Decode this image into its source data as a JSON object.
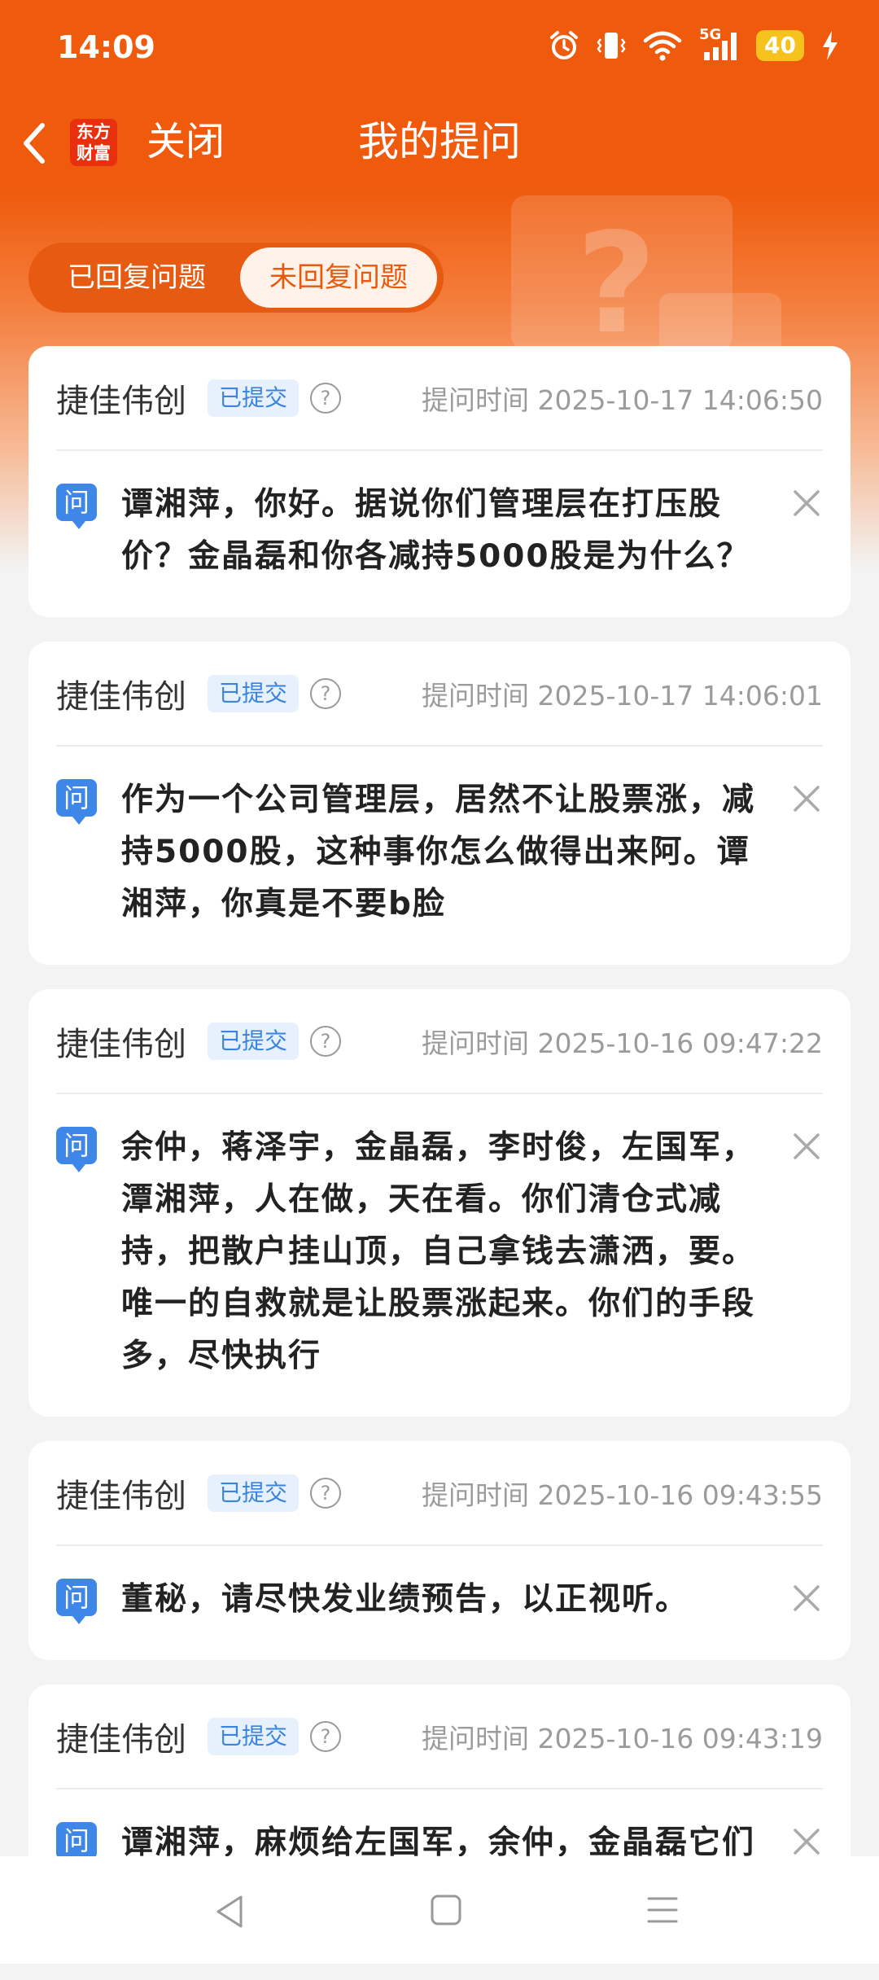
{
  "status_bar": {
    "time": "14:09",
    "network": "5G",
    "battery": "40",
    "icons": [
      "alarm-icon",
      "vibrate-icon",
      "wifi-icon",
      "signal-icon",
      "battery-icon",
      "charging-icon"
    ]
  },
  "header": {
    "back_icon": "chevron-left-icon",
    "brand_line1": "东方",
    "brand_line2": "财富",
    "close_label": "关闭",
    "title": "我的提问"
  },
  "tabs": [
    {
      "label": "已回复问题",
      "active": false
    },
    {
      "label": "未回复问题",
      "active": true
    }
  ],
  "questions": [
    {
      "company": "捷佳伟创",
      "status": "已提交",
      "time": "提问时间 2025-10-17 14:06:50",
      "q_label": "问",
      "text": "谭湘萍，你好。据说你们管理层在打压股价？金晶磊和你各减持5000股是为什么？"
    },
    {
      "company": "捷佳伟创",
      "status": "已提交",
      "time": "提问时间 2025-10-17 14:06:01",
      "q_label": "问",
      "text": "作为一个公司管理层，居然不让股票涨，减持5000股，这种事你怎么做得出来阿。谭湘萍，你真是不要b脸"
    },
    {
      "company": "捷佳伟创",
      "status": "已提交",
      "time": "提问时间 2025-10-16 09:47:22",
      "q_label": "问",
      "text": "余仲，蒋泽宇，金晶磊，李时俊，左国军，潭湘萍，人在做，天在看。你们清仓式减持，把散户挂山顶，自己拿钱去潇洒，要。唯一的自救就是让股票涨起来。你们的手段多，尽快执行"
    },
    {
      "company": "捷佳伟创",
      "status": "已提交",
      "time": "提问时间 2025-10-16 09:43:55",
      "q_label": "问",
      "text": "董秘，请尽快发业绩预告，以正视听。"
    },
    {
      "company": "捷佳伟创",
      "status": "已提交",
      "time": "提问时间 2025-10-16 09:43:19",
      "q_label": "问",
      "text": "谭湘萍，麻烦给左国军，余仲，金晶磊它们带个话，它们这群无耻之徒不做市值管"
    }
  ],
  "colors": {
    "brand_orange": "#ef5a0c",
    "badge_blue": "#3a84e0",
    "question_icon_blue": "#3e86e8"
  }
}
